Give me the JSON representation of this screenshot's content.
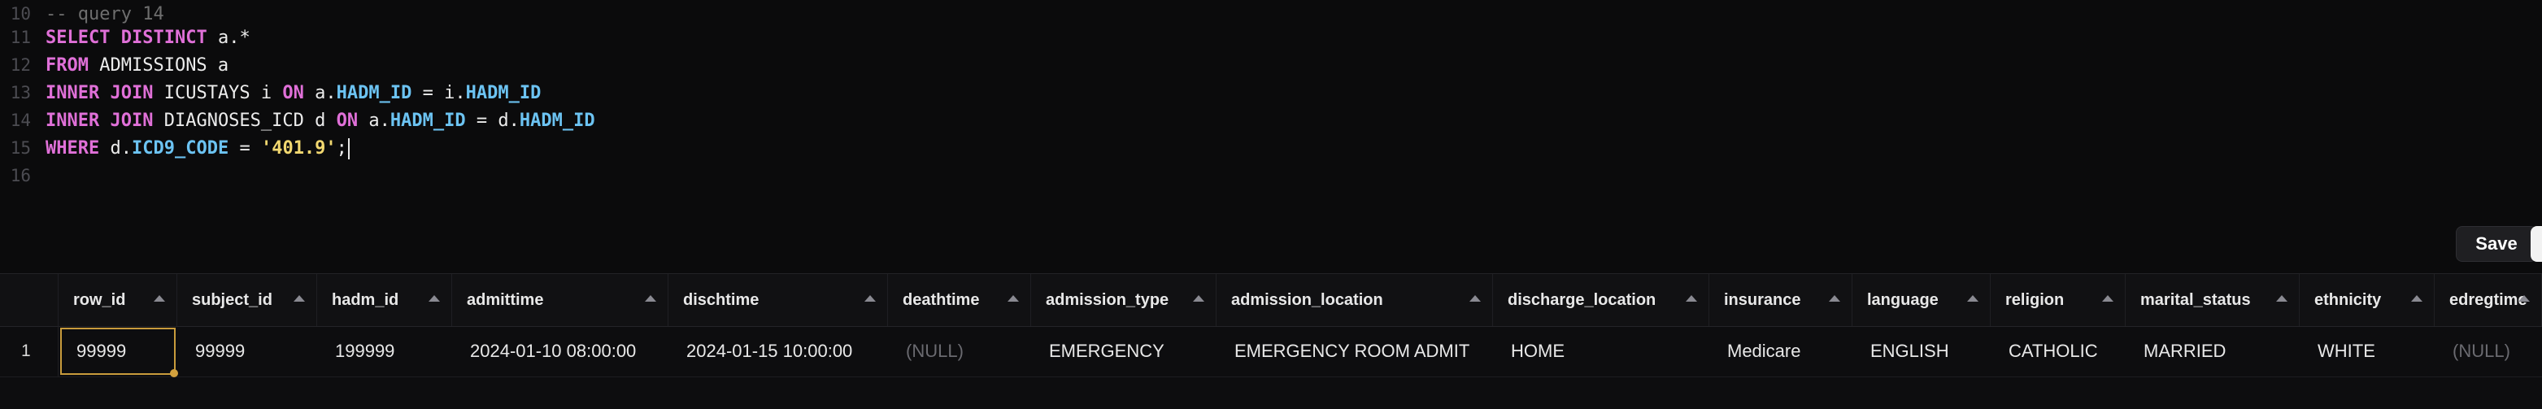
{
  "editor": {
    "lines": [
      {
        "num": "10",
        "tokens": [
          {
            "t": "-- query 14",
            "c": "cmt"
          }
        ]
      },
      {
        "num": "11",
        "tokens": [
          {
            "t": "SELECT",
            "c": "kw"
          },
          {
            "t": " "
          },
          {
            "t": "DISTINCT",
            "c": "kw"
          },
          {
            "t": " a.*",
            "c": "pl"
          }
        ]
      },
      {
        "num": "12",
        "tokens": [
          {
            "t": "FROM",
            "c": "kw"
          },
          {
            "t": " ADMISSIONS a",
            "c": "pl"
          }
        ]
      },
      {
        "num": "13",
        "tokens": [
          {
            "t": "INNER",
            "c": "kw"
          },
          {
            "t": " "
          },
          {
            "t": "JOIN",
            "c": "kw"
          },
          {
            "t": " ICUSTAYS i ",
            "c": "pl"
          },
          {
            "t": "ON",
            "c": "kw"
          },
          {
            "t": " a.",
            "c": "pl"
          },
          {
            "t": "HADM_ID",
            "c": "col"
          },
          {
            "t": " = i.",
            "c": "pl"
          },
          {
            "t": "HADM_ID",
            "c": "col"
          }
        ]
      },
      {
        "num": "14",
        "tokens": [
          {
            "t": "INNER",
            "c": "kw"
          },
          {
            "t": " "
          },
          {
            "t": "JOIN",
            "c": "kw"
          },
          {
            "t": " DIAGNOSES_ICD d ",
            "c": "pl"
          },
          {
            "t": "ON",
            "c": "kw"
          },
          {
            "t": " a.",
            "c": "pl"
          },
          {
            "t": "HADM_ID",
            "c": "col"
          },
          {
            "t": " = d.",
            "c": "pl"
          },
          {
            "t": "HADM_ID",
            "c": "col"
          }
        ]
      },
      {
        "num": "15",
        "tokens": [
          {
            "t": "WHERE",
            "c": "kw"
          },
          {
            "t": " d.",
            "c": "pl"
          },
          {
            "t": "ICD9_CODE",
            "c": "col"
          },
          {
            "t": " = ",
            "c": "pl"
          },
          {
            "t": "'401.9'",
            "c": "str"
          },
          {
            "t": ";",
            "c": "pl"
          }
        ],
        "caret": true
      },
      {
        "num": "16",
        "tokens": []
      }
    ]
  },
  "toolbar": {
    "save_label": "Save"
  },
  "grid": {
    "columns": [
      {
        "key": "row_id",
        "label": "row_id"
      },
      {
        "key": "subject_id",
        "label": "subject_id"
      },
      {
        "key": "hadm_id",
        "label": "hadm_id"
      },
      {
        "key": "admittime",
        "label": "admittime"
      },
      {
        "key": "dischtime",
        "label": "dischtime"
      },
      {
        "key": "deathtime",
        "label": "deathtime"
      },
      {
        "key": "admission_type",
        "label": "admission_type"
      },
      {
        "key": "admission_location",
        "label": "admission_location"
      },
      {
        "key": "discharge_location",
        "label": "discharge_location"
      },
      {
        "key": "insurance",
        "label": "insurance"
      },
      {
        "key": "language",
        "label": "language"
      },
      {
        "key": "religion",
        "label": "religion"
      },
      {
        "key": "marital_status",
        "label": "marital_status"
      },
      {
        "key": "ethnicity",
        "label": "ethnicity"
      },
      {
        "key": "edregtime",
        "label": "edregtime"
      }
    ],
    "rows": [
      {
        "num": "1",
        "cells": [
          "99999",
          "99999",
          "199999",
          "2024-01-10 08:00:00",
          "2024-01-15 10:00:00",
          "(NULL)",
          "EMERGENCY",
          "EMERGENCY ROOM ADMIT",
          "HOME",
          "Medicare",
          "ENGLISH",
          "CATHOLIC",
          "MARRIED",
          "WHITE",
          "(NULL)"
        ]
      }
    ],
    "selected_cell": {
      "row": 0,
      "col": 0
    }
  }
}
